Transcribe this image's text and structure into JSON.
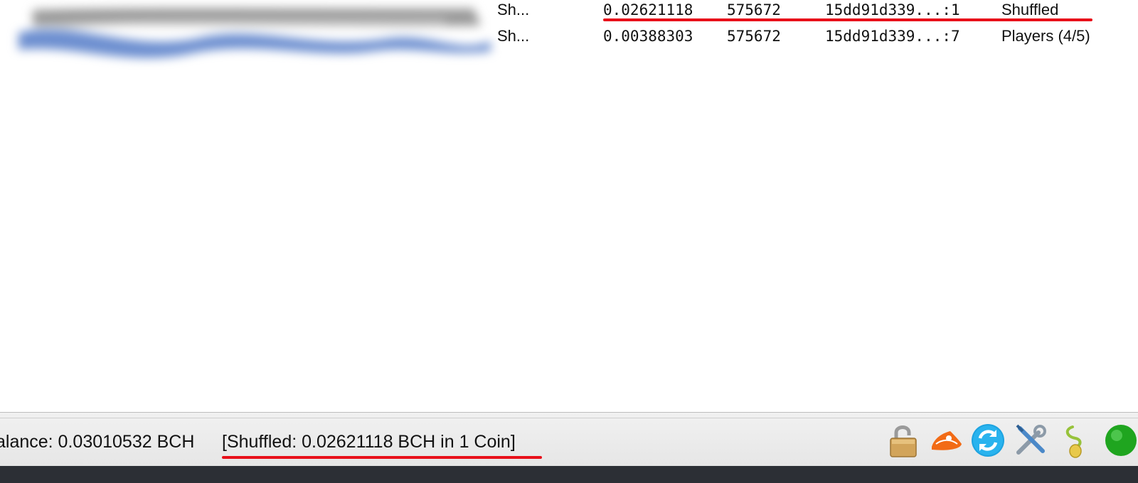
{
  "coins": [
    {
      "label": "Sh...",
      "amount": "0.02621118",
      "height": "575672",
      "output": "15dd91d339...:1",
      "status": "Shuffled"
    },
    {
      "label": "Sh...",
      "amount": "0.00388303",
      "height": "575672",
      "output": "15dd91d339...:7",
      "status": "Players (4/5)"
    }
  ],
  "statusbar": {
    "balance": "alance: 0.03010532 BCH",
    "shuffled": "[Shuffled: 0.02621118 BCH in 1 Coin]",
    "icons": [
      "lock-icon",
      "cashshuffle-icon",
      "sync-icon",
      "preferences-icon",
      "seed-icon",
      "network-status-icon"
    ]
  },
  "colors": {
    "highlight_underline": "#e8101a",
    "statusbar_bg": "#ececec",
    "dock_bg": "#2c2f35"
  }
}
